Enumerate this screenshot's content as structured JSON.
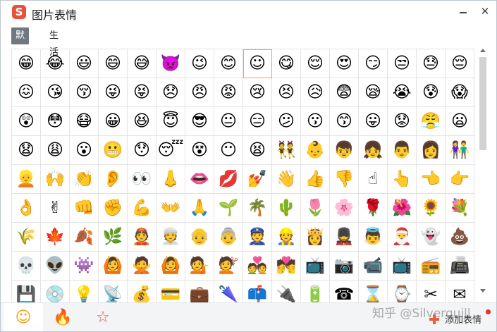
{
  "window": {
    "title": "图片表情",
    "logo_glyph": "S"
  },
  "tabs": [
    {
      "label": "默认"
    },
    {
      "label": "生活"
    }
  ],
  "bottom": {
    "watermark": "知乎 @Silverquill",
    "add_label": "添加表情",
    "tabs": [
      {
        "icon": "smiley-tab-icon",
        "glyph": "☺"
      },
      {
        "icon": "fire-face-tab-icon",
        "glyph": "🔥"
      },
      {
        "icon": "star-tab-icon",
        "glyph": "☆"
      }
    ]
  },
  "selected_index": 8,
  "emoji": [
    "😁",
    "😂",
    "😃",
    "😄",
    "😅",
    "👿",
    "😉",
    "😊",
    "☺",
    "😋",
    "😌",
    "😍",
    "😏",
    "😒",
    "😓",
    "😔",
    "😖",
    "😘",
    "😚",
    "😜",
    "😝",
    "😞",
    "😠",
    "😡",
    "😢",
    "😣",
    "😥",
    "😨",
    "😪",
    "😭",
    "😰",
    "😱",
    "😲",
    "😳",
    "😷",
    "😀",
    "😆",
    "😇",
    "😎",
    "😐",
    "😑",
    "😕",
    "😗",
    "😙",
    "😛",
    "😟",
    "😤",
    "😦",
    "😧",
    "😩",
    "😮",
    "😬",
    "😯",
    "😴",
    "😵",
    "😶",
    "😫",
    "👯",
    "👶",
    "👦",
    "👧",
    "👨",
    "👩",
    "👫",
    "👱",
    "🙌",
    "👏",
    "👂",
    "👀",
    "👃",
    "👄",
    "💋",
    "💅",
    "👋",
    "👍",
    "👎",
    "☝",
    "👆",
    "👈",
    "👉",
    "👌",
    "✌",
    "👊",
    "✊",
    "💪",
    "👐",
    "🙏",
    "🌱",
    "🌴",
    "🌵",
    "🌷",
    "🌸",
    "🌹",
    "🌺",
    "🌻",
    "💐",
    "🌾",
    "🍁",
    "🍂",
    "🌿",
    "👲",
    "👳",
    "👴",
    "👵",
    "👮",
    "👷",
    "👸",
    "💂",
    "👼",
    "🎅",
    "👻",
    "💩",
    "💀",
    "👽",
    "👾",
    "🙆",
    "🙅",
    "🙆",
    "💁",
    "💇",
    "💑",
    "💏",
    "📺",
    "📷",
    "📹",
    "📺",
    "📻",
    "📠",
    "💾",
    "💿",
    "💡",
    "📡",
    "💰",
    "💳",
    "💼",
    "🌂",
    "📫",
    "🔌",
    "🔋",
    "☎",
    "⌛",
    "⌚",
    "✂",
    "✉"
  ]
}
